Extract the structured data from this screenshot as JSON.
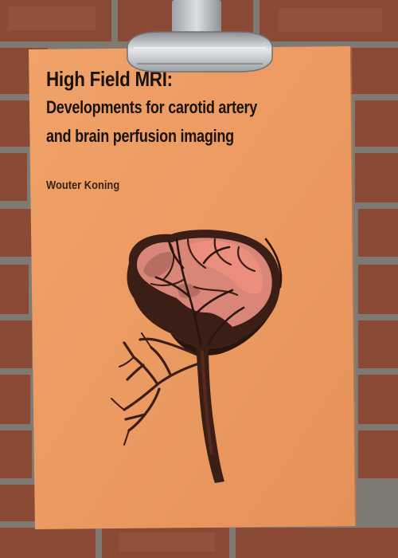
{
  "cover": {
    "title_line1": "High Field MRI:",
    "title_line2": "Developments for carotid artery",
    "title_line3": "and brain perfusion imaging",
    "author": "Wouter Koning"
  },
  "colors": {
    "cover_orange": "#eb9a62",
    "brick": "#8a4a35",
    "mortar": "#7f7a74",
    "title_text": "#1a120c",
    "brain_pink": "#d98577",
    "brain_dark": "#3b1e16"
  },
  "icons": {
    "clip": "binder-clip-icon",
    "illustration": "brain-vessel-illustration"
  }
}
